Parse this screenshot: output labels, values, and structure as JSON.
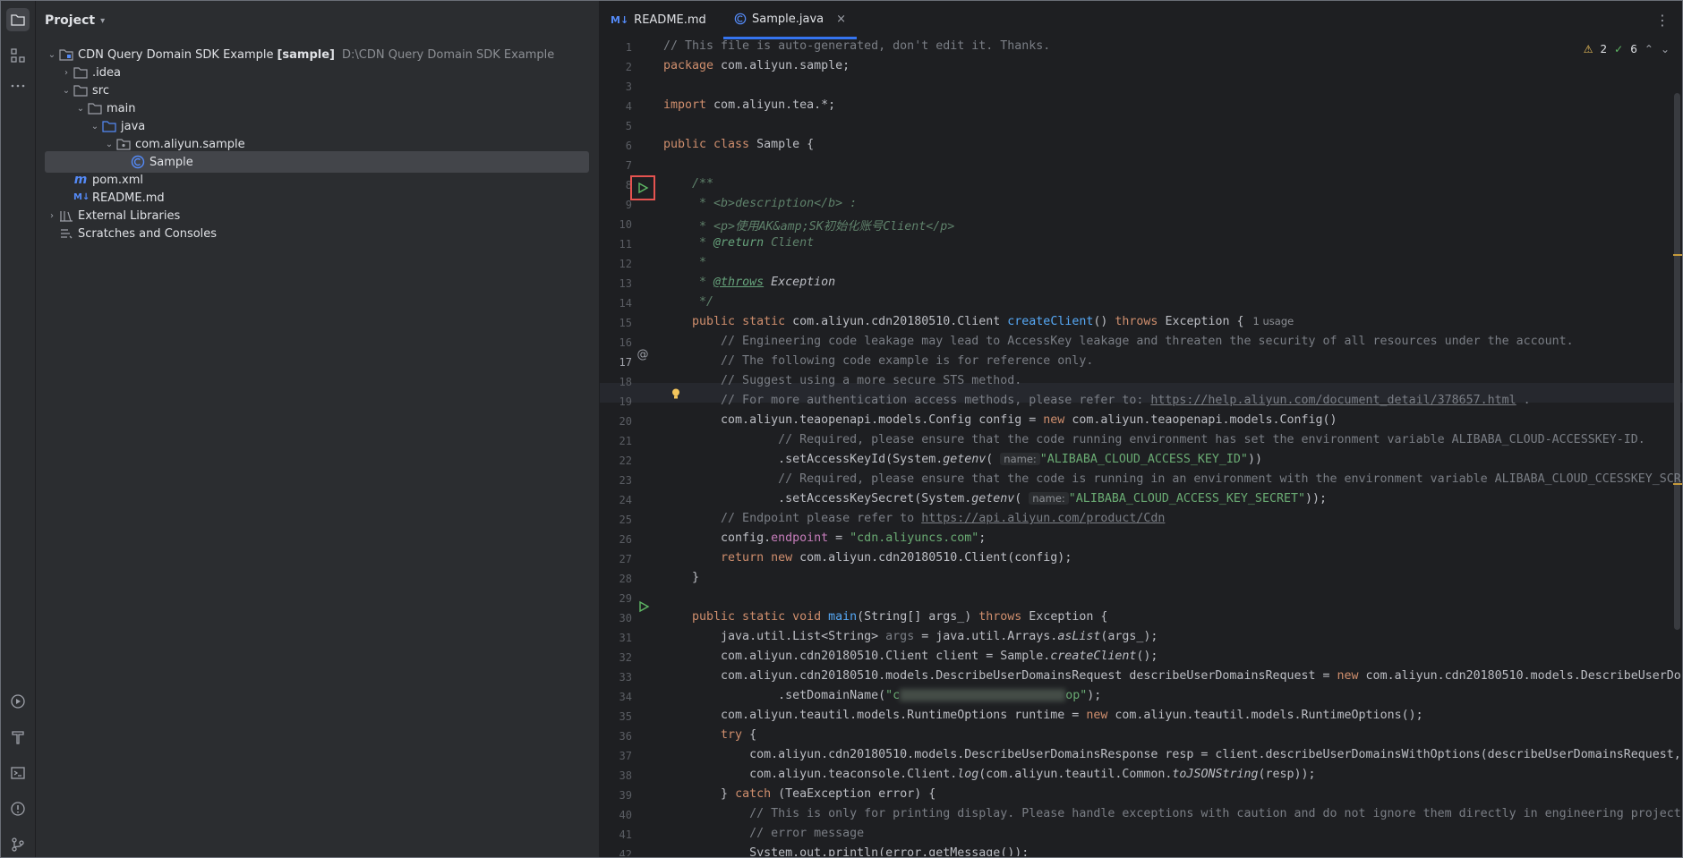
{
  "project": {
    "title": "Project",
    "tree": [
      {
        "label": "CDN Query Domain SDK Example",
        "tag": "[sample]",
        "path": "D:\\CDN Query Domain SDK Example"
      },
      {
        "label": ".idea"
      },
      {
        "label": "src"
      },
      {
        "label": "main"
      },
      {
        "label": "java"
      },
      {
        "label": "com.aliyun.sample"
      },
      {
        "label": "Sample"
      },
      {
        "label": "pom.xml"
      },
      {
        "label": "README.md"
      },
      {
        "label": "External Libraries"
      },
      {
        "label": "Scratches and Consoles"
      }
    ]
  },
  "tabs": [
    {
      "label": "README.md",
      "badge": "M↓"
    },
    {
      "label": "Sample.java"
    }
  ],
  "inspections": {
    "warnings": "2",
    "ok": "6"
  },
  "editor": {
    "current_line": 17,
    "line_numbers": [
      "1",
      "2",
      "3",
      "4",
      "5",
      "6",
      "7",
      "8",
      "9",
      "10",
      "11",
      "12",
      "13",
      "14",
      "15",
      "16",
      "17",
      "18",
      "19",
      "20",
      "21",
      "22",
      "23",
      "24",
      "25",
      "26",
      "27",
      "28",
      "29",
      "30",
      "31",
      "32",
      "33",
      "34",
      "35",
      "36",
      "37",
      "38",
      "39",
      "40",
      "41",
      "42"
    ],
    "l1": "// This file is auto-generated, don't edit it. Thanks.",
    "l2_kw": "package",
    "l2": " com.aliyun.sample;",
    "l4_kw": "import",
    "l4": " com.aliyun.tea.*;",
    "l6_kw": "public class",
    "l6": " Sample {",
    "l8": "    /**",
    "l9a": "     * ",
    "l9b": "<b>description</b>",
    "l9c": " :",
    "l10a": "     * ",
    "l10b": "<p>使用AK&amp;SK初始化账号Client</p>",
    "l11a": "     * ",
    "l11b": "@return",
    "l11c": " Client",
    "l12": "     *",
    "l13a": "     * ",
    "l13b": "@throws",
    "l13c": " Exception",
    "l14": "     */",
    "l15_kw": "public static",
    "l15a": " com.aliyun.cdn20180510.Client ",
    "l15_fn": "createClient",
    "l15b": "() ",
    "l15_kw2": "throws",
    "l15c": " Exception {",
    "l15_usage": "1 usage",
    "l16": "        // Engineering code leakage may lead to AccessKey leakage and threaten the security of all resources under the account.",
    "l17": "        // The following code example is for reference only.",
    "l18": "        // Suggest using a more secure STS method.",
    "l19a": "        // For more authentication access methods, please refer to: ",
    "l19_link": "https://help.aliyun.com/document_detail/378657.html",
    "l19b": " .",
    "l20a": "        com.aliyun.teaopenapi.models.Config config = ",
    "l20_kw": "new",
    "l20b": " com.aliyun.teaopenapi.models.Config()",
    "l21": "                // Required, please ensure that the code running environment has set the environment variable ALIBABA_CLOUD-ACCESSKEY-ID.",
    "l22a": "                .setAccessKeyId(System.",
    "l22_it": "getenv",
    "l22b": "( ",
    "l22_hint": "name:",
    "l22_str": "\"ALIBABA_CLOUD_ACCESS_KEY_ID\"",
    "l22c": "))",
    "l23": "                // Required, please ensure that the code is running in an environment with the environment variable ALIBABA_CLOUD_CCESSKEY_SCR",
    "l24a": "                .setAccessKeySecret(System.",
    "l24_it": "getenv",
    "l24b": "( ",
    "l24_hint": "name:",
    "l24_str": "\"ALIBABA_CLOUD_ACCESS_KEY_SECRET\"",
    "l24c": "));",
    "l25a": "        // Endpoint please refer to ",
    "l25_link": "https://api.aliyun.com/product/Cdn",
    "l26a": "        config.",
    "l26_fld": "endpoint",
    "l26b": " = ",
    "l26_str": "\"cdn.aliyuncs.com\"",
    "l26c": ";",
    "l27_kw": "        return new",
    "l27": " com.aliyun.cdn20180510.Client(config);",
    "l28": "    }",
    "l30_kw": "    public static void",
    "l30_fn": " main",
    "l30a": "(String[] args_) ",
    "l30_kw2": "throws",
    "l30b": " Exception {",
    "l31a": "        java.util.List<String> ",
    "l31_var": "args",
    "l31b": " = java.util.Arrays.",
    "l31_it": "asList",
    "l31c": "(args_);",
    "l32a": "        com.aliyun.cdn20180510.Client client = Sample.",
    "l32_it": "createClient",
    "l32b": "();",
    "l33a": "        com.aliyun.cdn20180510.models.DescribeUserDomainsRequest describeUserDomainsRequest = ",
    "l33_kw": "new",
    "l33b": " com.aliyun.cdn20180510.models.DescribeUserDo",
    "l34a": "                .setDomainName(",
    "l34_str1": "\"c",
    "l34_str2": "op\"",
    "l34b": ");",
    "l35a": "        com.aliyun.teautil.models.RuntimeOptions runtime = ",
    "l35_kw": "new",
    "l35b": " com.aliyun.teautil.models.RuntimeOptions();",
    "l36_kw": "        try",
    "l36": " {",
    "l37": "            com.aliyun.cdn20180510.models.DescribeUserDomainsResponse resp = client.describeUserDomainsWithOptions(describeUserDomainsRequest,",
    "l38a": "            com.aliyun.teaconsole.Client.",
    "l38_it": "log",
    "l38b": "(com.aliyun.teautil.Common.",
    "l38_it2": "toJSONString",
    "l38c": "(resp));",
    "l39a": "        } ",
    "l39_kw": "catch",
    "l39b": " (TeaException error) {",
    "l40": "            // This is only for printing display. Please handle exceptions with caution and do not ignore them directly in engineering project",
    "l41": "            // error message",
    "l42": "            System.out.println(error.getMessage());"
  }
}
